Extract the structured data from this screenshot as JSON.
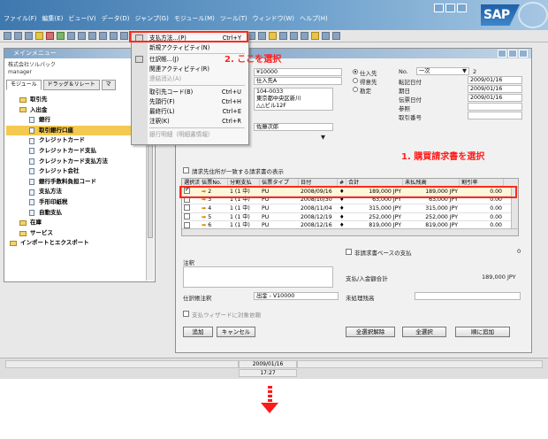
{
  "menubar": [
    "ファイル(F)",
    "編集(E)",
    "ビュー(V)",
    "データ(D)",
    "ジャンプ(G)",
    "モジュール(M)",
    "ツール(T)",
    "ウィンドウ(W)",
    "ヘルプ(H)"
  ],
  "brand": "SAP",
  "main_menu": {
    "title": "メインメニュー",
    "company": "株式会社ソルパック",
    "user": "manager",
    "tabs": [
      "モジュール",
      "ドラッグ＆リレート",
      "マ"
    ],
    "tree": [
      {
        "label": "取引先",
        "kind": "folder",
        "level": 1
      },
      {
        "label": "入出金",
        "kind": "folder",
        "level": 1
      },
      {
        "label": "銀行",
        "kind": "doc",
        "level": 2
      },
      {
        "label": "取引銀行口座",
        "kind": "doc",
        "level": 2,
        "selected": true
      },
      {
        "label": "クレジットカード",
        "kind": "doc",
        "level": 2
      },
      {
        "label": "クレジットカード支払",
        "kind": "doc",
        "level": 2
      },
      {
        "label": "クレジットカード支払方法",
        "kind": "doc",
        "level": 2
      },
      {
        "label": "クレジット会社",
        "kind": "doc",
        "level": 2
      },
      {
        "label": "銀行手数料負担コード",
        "kind": "doc",
        "level": 2
      },
      {
        "label": "支払方法",
        "kind": "doc",
        "level": 2
      },
      {
        "label": "手形印紙税",
        "kind": "doc",
        "level": 2
      },
      {
        "label": "自動支払",
        "kind": "doc",
        "level": 2
      },
      {
        "label": "在庫",
        "kind": "folder",
        "level": 1
      },
      {
        "label": "サービス",
        "kind": "folder",
        "level": 1
      },
      {
        "label": "インポートとエクスポート",
        "kind": "folder",
        "level": 0
      }
    ]
  },
  "context_menu": {
    "items": [
      {
        "label": "支払方法...(P)",
        "shortcut": "Ctrl+Y",
        "disabled": false
      },
      {
        "label": "新規アクティビティ(N)",
        "shortcut": "",
        "disabled": false
      },
      {
        "label": "仕訳帳...(J)",
        "shortcut": "",
        "disabled": false
      },
      {
        "label": "関連アクティビティ(R)",
        "shortcut": "",
        "disabled": false
      },
      {
        "label": "連結消込(A)",
        "shortcut": "",
        "disabled": true
      },
      {
        "label": "取引先コード(B)",
        "shortcut": "Ctrl+U",
        "disabled": false
      },
      {
        "label": "先頭行(F)",
        "shortcut": "Ctrl+H",
        "disabled": false
      },
      {
        "label": "最終行(L)",
        "shortcut": "Ctrl+E",
        "disabled": false
      },
      {
        "label": "注釈(K)",
        "shortcut": "Ctrl+R",
        "disabled": false
      },
      {
        "label": "銀行明細（明細書情報）",
        "shortcut": "",
        "disabled": true
      }
    ]
  },
  "payment": {
    "amount_field": "¥10000",
    "name_field": "仕入先A",
    "address": [
      "104-0033",
      "東京都中央区新川",
      "△△ビル12F"
    ],
    "contact": "佐藤次郎",
    "radios": [
      {
        "label": "仕入先",
        "checked": true
      },
      {
        "label": "得意先",
        "checked": false
      },
      {
        "label": "勘定",
        "checked": false
      }
    ],
    "no_label": "No.",
    "series": "一次",
    "doc_number": "2",
    "right_fields": [
      {
        "label": "転記日付",
        "value": "2009/01/16"
      },
      {
        "label": "期日",
        "value": "2009/01/16"
      },
      {
        "label": "伝票日付",
        "value": "2009/01/16"
      },
      {
        "label": "参照",
        "value": ""
      },
      {
        "label": "取引番号",
        "value": ""
      }
    ],
    "show_checkbox_label": "請求先住所が一致する請求書の表示",
    "columns": [
      "選択済",
      "伝票No.",
      "分割支払",
      "伝票タイプ",
      "日付",
      "#",
      "合計",
      "未払残高",
      "割引率"
    ],
    "rows": [
      {
        "checked": true,
        "no": "2",
        "split": "1 (1 中)",
        "type": "PU",
        "date": "2008/09/16",
        "mark": "♦",
        "total": "189,000 JPY",
        "balance": "189,000 JPY",
        "discount": "0.00"
      },
      {
        "checked": false,
        "no": "3",
        "split": "1 (1 中)",
        "type": "PU",
        "date": "2008/10/30",
        "mark": "♦",
        "total": "63,000 JPY",
        "balance": "63,000 JPY",
        "discount": "0.00"
      },
      {
        "checked": false,
        "no": "4",
        "split": "1 (1 中)",
        "type": "PU",
        "date": "2008/11/04",
        "mark": "♦",
        "total": "315,000 JPY",
        "balance": "315,000 JPY",
        "discount": "0.00"
      },
      {
        "checked": false,
        "no": "5",
        "split": "1 (1 中)",
        "type": "PU",
        "date": "2008/12/19",
        "mark": "♦",
        "total": "252,000 JPY",
        "balance": "252,000 JPY",
        "discount": "0.00"
      },
      {
        "checked": false,
        "no": "6",
        "split": "1 (1 中)",
        "type": "PU",
        "date": "2008/12/16",
        "mark": "♦",
        "total": "819,000 JPY",
        "balance": "819,000 JPY",
        "discount": "0.00"
      }
    ],
    "nonjpy_label": "非請求書ベースの支払",
    "nonjpy_value": "0",
    "remarks_label": "注釈",
    "total_label": "支払/入金額合計",
    "total_value": "189,000 JPY",
    "journal_label": "仕訳帳注釈",
    "journal_value": "出金 - V10000",
    "unprocessed_label": "未処理残高",
    "wizard_label": "支払ウィザードに対象依頼",
    "buttons": {
      "add": "追加",
      "cancel": "キャンセル",
      "deselect_all": "全選択解除",
      "select_all": "全選択",
      "sequence": "順に追加"
    }
  },
  "notes": {
    "step1": "1. 購買請求書を選択",
    "step2": "2. ここを選択"
  },
  "status": {
    "date": "2009/01/16",
    "time": "17:27"
  },
  "colors": {
    "highlight": "#ff2a1a",
    "selection": "#f3c94f",
    "titlebar": "#3e78ae"
  }
}
